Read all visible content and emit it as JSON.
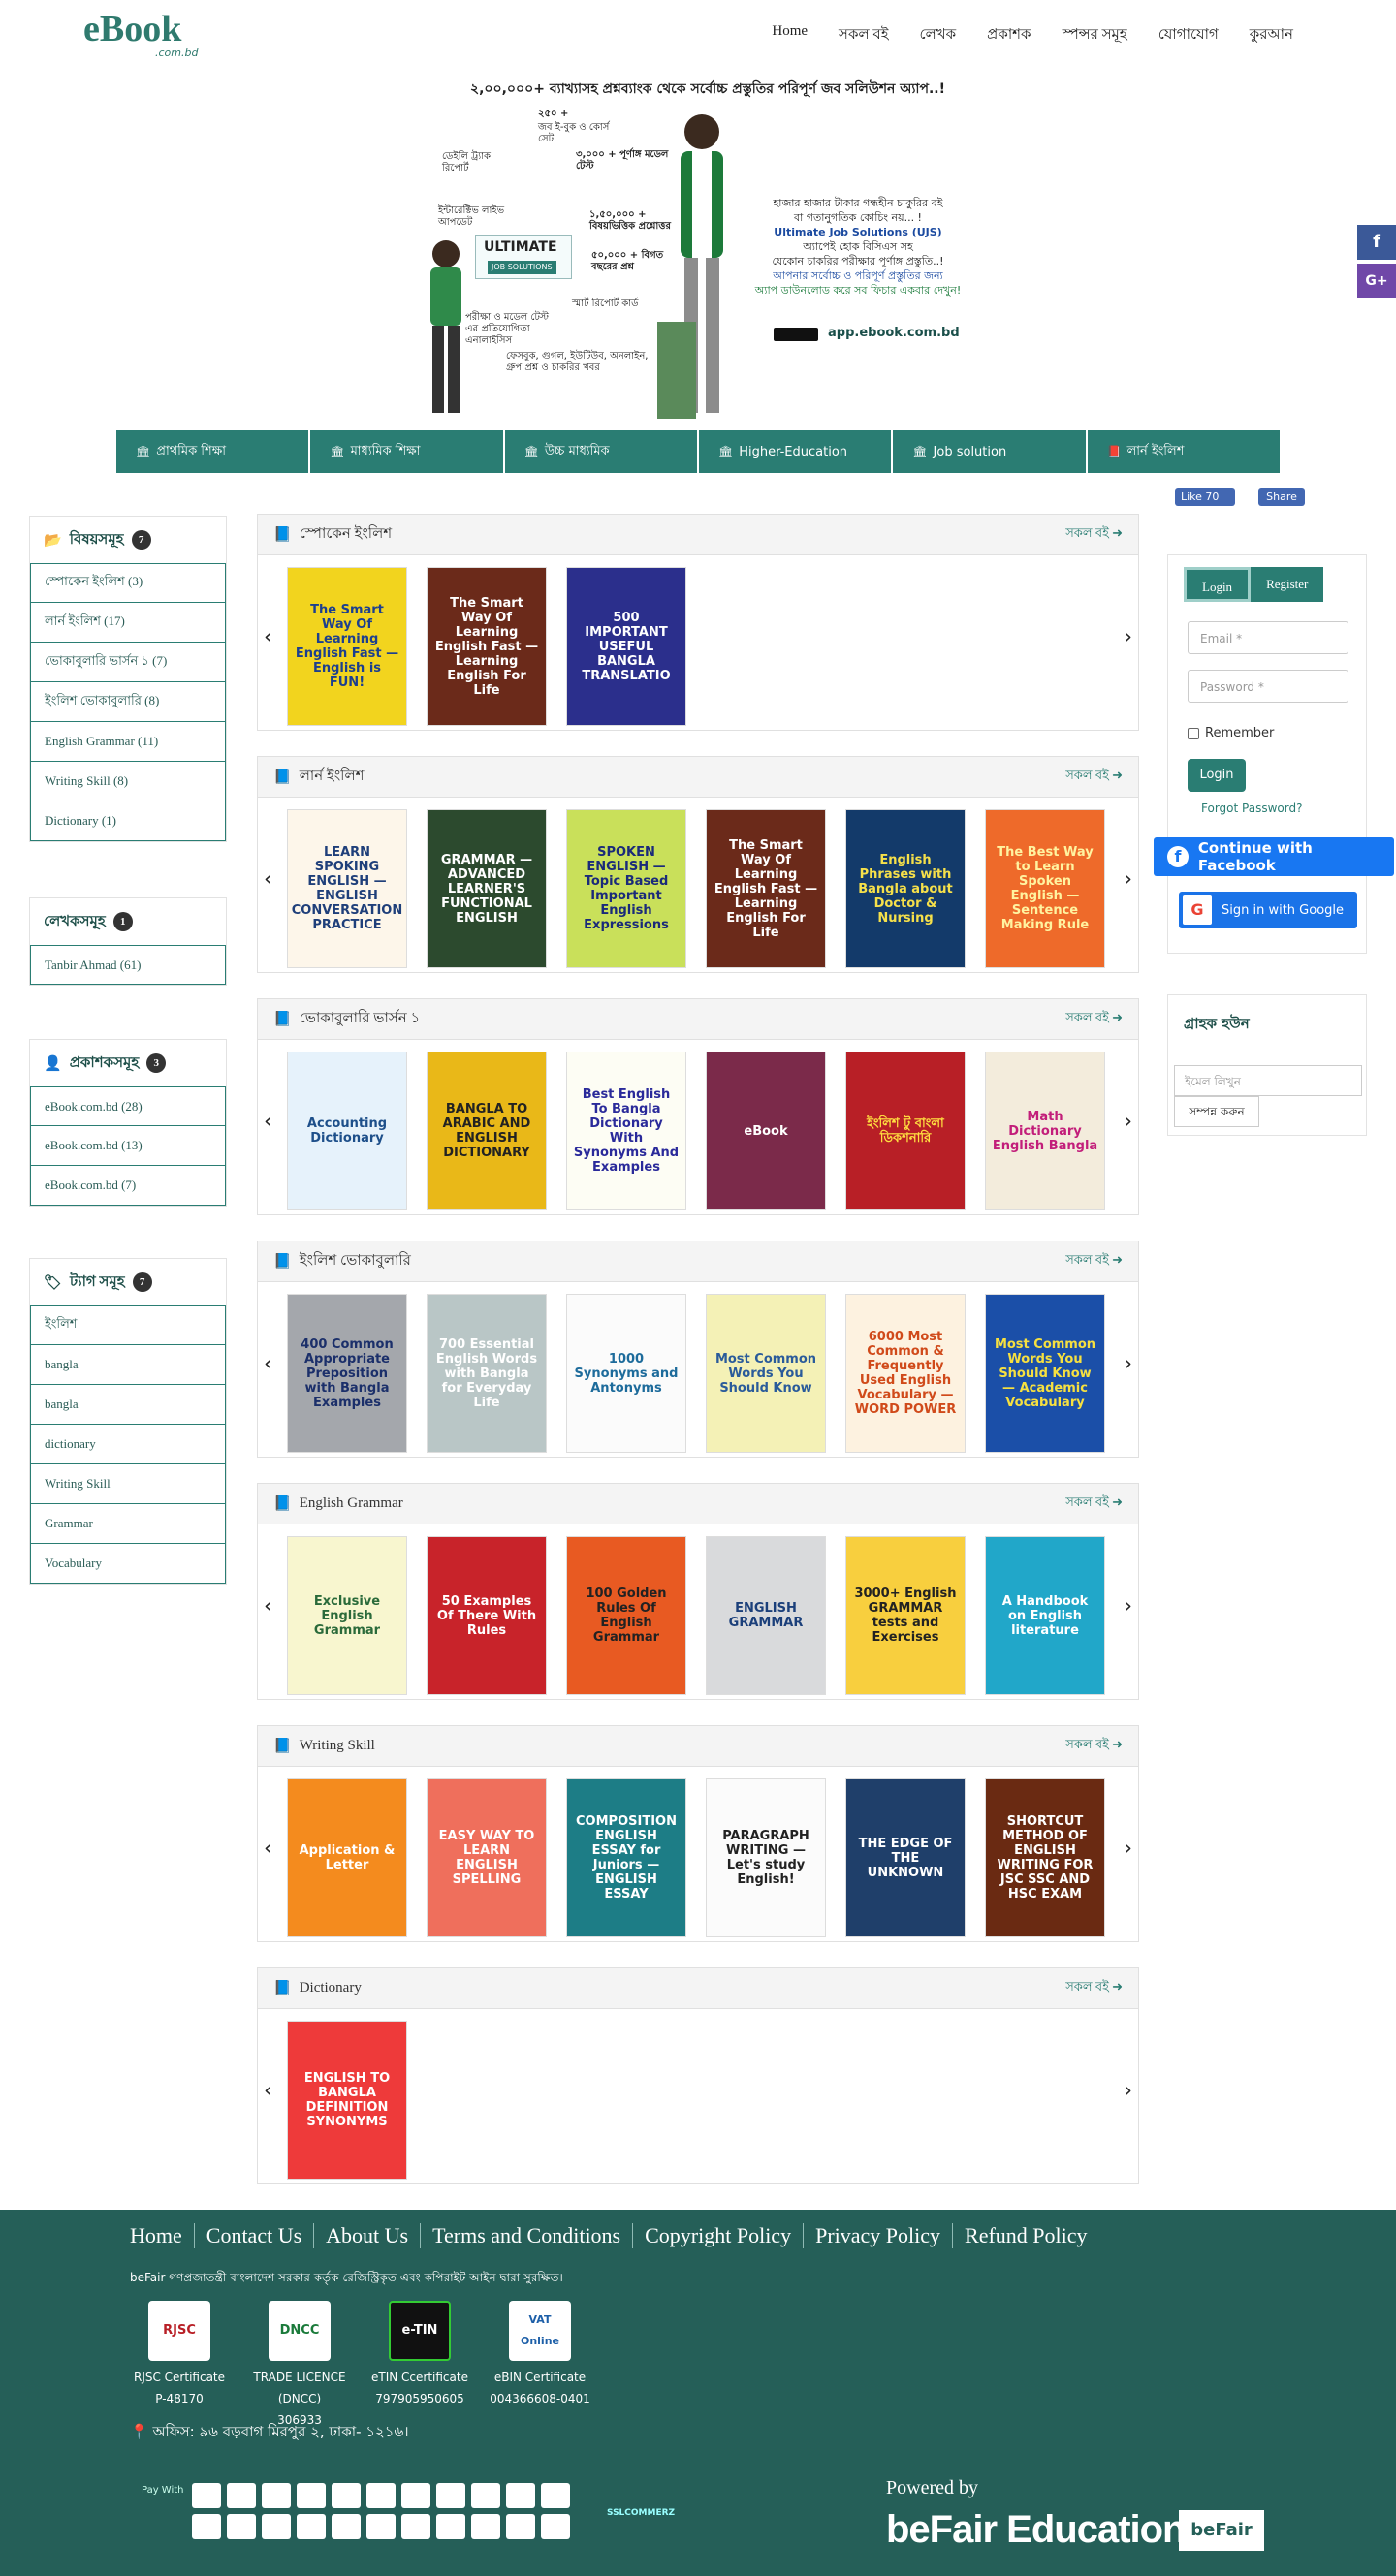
{
  "header": {
    "logo_main": "eBook",
    "logo_sub": ".com.bd",
    "nav": [
      "Home",
      "সকল বই",
      "লেখক",
      "প্রকাশক",
      "স্পন্সর সমূহ",
      "যোগাযোগ",
      "কুরআন"
    ]
  },
  "banner": {
    "title": "২,০০,০০০+ ব্যাখ্যাসহ প্রশ্নব্যাংক থেকে সর্বোচ্চ প্রস্তুতির পরিপূর্ণ জব সলিউশন অ্যাপ..!",
    "labels": [
      "২৫০ +",
      "জব ই-বুক ও কোর্স সেট",
      "ডেইলি ট্র্যাক রিপোর্ট",
      "৩,০০০ + পূর্ণাঙ্গ মডেল টেস্ট",
      "ইন্টারেক্টিভ লাইভ আপডেট",
      "১,৫০,০০০ + বিষয়ভিত্তিক প্রশ্নোত্তর",
      "৫০,০০০ + বিগত বছরের প্রশ্ন",
      "ULTIMATE",
      "JOB SOLUTIONS",
      "স্মার্ট রিপোর্ট কার্ড",
      "পরীক্ষা ও মডেল টেস্ট এর প্রতিযোগিতা এনালাইসিস",
      "ফেসবুক, গুগল, ইউটিউব, অনলাইন, গ্রুপ প্রশ্ন ও চাকরির খবর"
    ],
    "right_text": [
      "হাজার হাজার টাকার গন্ধহীন চাকুরির বই",
      "বা গতানুগতিক কোচিং নয়... !",
      "Ultimate Job Solutions (UJS)",
      "অ্যাপেই হোক বিসিএস সহ",
      "যেকোন চাকরির পরীক্ষার পূর্ণাঙ্গ প্রস্তুতি..!",
      "আপনার সর্বোচ্চ ও পরিপূর্ণ প্রস্তুতির জন্য",
      "অ্যাপ ডাউনলোড করে সব ফিচার একবার দেখুন!"
    ],
    "url": "app.ebook.com.bd"
  },
  "categories": [
    {
      "icon": "building-icon",
      "glyph": "🏛",
      "label": "প্রাথমিক শিক্ষা"
    },
    {
      "icon": "building-icon",
      "glyph": "🏛",
      "label": "মাধ্যমিক শিক্ষা"
    },
    {
      "icon": "building-icon",
      "glyph": "🏛",
      "label": "উচ্চ মাধ্যমিক"
    },
    {
      "icon": "building-icon",
      "glyph": "🏛",
      "label": "Higher-Education"
    },
    {
      "icon": "building-icon",
      "glyph": "🏛",
      "label": "Job solution"
    },
    {
      "icon": "book-icon",
      "glyph": "📕",
      "label": "লার্ন ইংলিশ"
    }
  ],
  "social": {
    "fb_like": "Like 70",
    "fb_share": "Share",
    "side_fb": "f",
    "side_gp": "G+"
  },
  "sidebar": {
    "subjects": {
      "title": "বিষয়সমূহ",
      "count": "7",
      "items": [
        "স্পোকেন ইংলিশ (3)",
        "লার্ন ইংলিশ (17)",
        "ভোকাবুলারি ভার্সন ১ (7)",
        "ইংলিশ ভোকাবুলারি (8)",
        "English Grammar (11)",
        "Writing Skill (8)",
        "Dictionary (1)"
      ]
    },
    "authors": {
      "title": "লেখকসমূহ",
      "count": "1",
      "items": [
        "Tanbir Ahmad (61)"
      ]
    },
    "publishers": {
      "title": "প্রকাশকসমূহ",
      "count": "3",
      "items": [
        "eBook.com.bd (28)",
        "eBook.com.bd (13)",
        "eBook.com.bd (7)"
      ]
    },
    "tags": {
      "title": "ট্যাগ সমূহ",
      "count": "7",
      "items": [
        "ইংলিশ",
        "bangla",
        "bangla",
        "dictionary",
        "Writing Skill",
        "Grammar",
        "Vocabulary"
      ]
    }
  },
  "sections": [
    {
      "title": "স্পোকেন ইংলিশ",
      "all": "সকল বই",
      "books": [
        {
          "text": "The Smart Way Of Learning English Fast — English is FUN!",
          "bg": "#f2d41e",
          "fg": "#1c3f8f"
        },
        {
          "text": "The Smart Way Of Learning English Fast — Learning English For Life",
          "bg": "#6b2a1a",
          "fg": "#ffffff"
        },
        {
          "text": "500 IMPORTANT USEFUL BANGLA TRANSLATIO",
          "bg": "#2b2f8c",
          "fg": "#ffffff"
        }
      ]
    },
    {
      "title": "লার্ন ইংলিশ",
      "all": "সকল বই",
      "books": [
        {
          "text": "LEARN SPOKING ENGLISH — ENGLISH CONVERSATION PRACTICE",
          "bg": "#fdf6ea",
          "fg": "#1f3f7a"
        },
        {
          "text": "GRAMMAR — ADVANCED LEARNER'S FUNCTIONAL ENGLISH",
          "bg": "#2c4a2e",
          "fg": "#ffffff"
        },
        {
          "text": "SPOKEN ENGLISH — Topic Based Important English Expressions",
          "bg": "#c9e05a",
          "fg": "#1a2a7a"
        },
        {
          "text": "The Smart Way Of Learning English Fast — Learning English For Life",
          "bg": "#6b2a1a",
          "fg": "#ffffff"
        },
        {
          "text": "English Phrases with Bangla about Doctor & Nursing",
          "bg": "#133a6a",
          "fg": "#f6e04a"
        },
        {
          "text": "The Best Way to Learn Spoken English — Sentence Making Rule",
          "bg": "#ee6a2a",
          "fg": "#fff3a0"
        }
      ]
    },
    {
      "title": "ভোকাবুলারি ভার্সন ১",
      "all": "সকল বই",
      "books": [
        {
          "text": "Accounting Dictionary",
          "bg": "#e6f2fb",
          "fg": "#1d4f8a"
        },
        {
          "text": "BANGLA TO ARABIC AND ENGLISH DICTIONARY",
          "bg": "#e9b818",
          "fg": "#222222"
        },
        {
          "text": "Best English To Bangla Dictionary With Synonyms And Examples",
          "bg": "#fdfdf4",
          "fg": "#2a2a9a"
        },
        {
          "text": "eBook",
          "bg": "#7b2a4a",
          "fg": "#ffffff"
        },
        {
          "text": "ইংলিশ টু বাংলা ডিকশনারি",
          "bg": "#b81f26",
          "fg": "#ffe040"
        },
        {
          "text": "Math Dictionary English Bangla",
          "bg": "#f3ecdc",
          "fg": "#c21e7a"
        }
      ]
    },
    {
      "title": "ইংলিশ ভোকাবুলারি",
      "all": "সকল বই",
      "books": [
        {
          "text": "400 Common Appropriate Preposition with Bangla Examples",
          "bg": "#a4a7ac",
          "fg": "#1b2f6a"
        },
        {
          "text": "700 Essential English Words with Bangla for Everyday Life",
          "bg": "#b9c6c6",
          "fg": "#ffffff"
        },
        {
          "text": "1000 Synonyms and Antonyms",
          "bg": "#fbfbfb",
          "fg": "#1d6b9b"
        },
        {
          "text": "Most Common Words You Should Know",
          "bg": "#f4f1b6",
          "fg": "#2a5b9a"
        },
        {
          "text": "6000 Most Common & Frequently Used English Vocabulary — WORD POWER",
          "bg": "#fdf2e0",
          "fg": "#d04a1a"
        },
        {
          "text": "Most Common Words You Should Know — Academic Vocabulary",
          "bg": "#1b4fa8",
          "fg": "#f6e040"
        }
      ]
    },
    {
      "title": "English Grammar",
      "all": "সকল বই",
      "books": [
        {
          "text": "Exclusive English Grammar",
          "bg": "#f8f6cf",
          "fg": "#2a6a3a"
        },
        {
          "text": "50 Examples Of There With Rules",
          "bg": "#c8232a",
          "fg": "#ffffff"
        },
        {
          "text": "100 Golden Rules Of English Grammar",
          "bg": "#e85a22",
          "fg": "#222222"
        },
        {
          "text": "ENGLISH GRAMMAR",
          "bg": "#d9dadc",
          "fg": "#1b3f7a"
        },
        {
          "text": "3000+ English GRAMMAR tests and Exercises",
          "bg": "#f8cf3e",
          "fg": "#222222"
        },
        {
          "text": "A Handbook on English literature",
          "bg": "#21a7c9",
          "fg": "#ffffff"
        }
      ]
    },
    {
      "title": "Writing Skill",
      "all": "সকল বই",
      "books": [
        {
          "text": "Application & Letter",
          "bg": "#f48b1e",
          "fg": "#ffffff"
        },
        {
          "text": "EASY WAY TO LEARN ENGLISH SPELLING",
          "bg": "#ef6f5c",
          "fg": "#ffffff"
        },
        {
          "text": "COMPOSITION ENGLISH ESSAY for Juniors — ENGLISH ESSAY",
          "bg": "#1d7d86",
          "fg": "#ffffff"
        },
        {
          "text": "PARAGRAPH WRITING — Let's study English!",
          "bg": "#fbfbfb",
          "fg": "#222222"
        },
        {
          "text": "THE EDGE OF THE UNKNOWN",
          "bg": "#1f3f6a",
          "fg": "#ffffff"
        },
        {
          "text": "SHORTCUT METHOD OF ENGLISH WRITING FOR JSC SSC AND HSC EXAM",
          "bg": "#6a2a12",
          "fg": "#ffffff"
        }
      ]
    },
    {
      "title": "Dictionary",
      "all": "সকল বই",
      "books": [
        {
          "text": "ENGLISH TO BANGLA DEFINITION SYNONYMS",
          "bg": "#ee3a3a",
          "fg": "#ffffff"
        }
      ]
    }
  ],
  "auth": {
    "tab_login": "Login",
    "tab_register": "Register",
    "email_placeholder": "Email *",
    "password_placeholder": "Password *",
    "remember": "Remember",
    "login_btn": "Login",
    "forgot": "Forgot Password?",
    "facebook": "Continue with Facebook",
    "google": "Sign in with Google"
  },
  "subscribe": {
    "title": "গ্রাহক হউন",
    "placeholder": "ইমেল লিখুন",
    "button": "সম্পন্ন করুন"
  },
  "footer": {
    "links": [
      "Home",
      "Contact Us",
      "About Us",
      "Terms and Conditions",
      "Copyright Policy",
      "Privacy Policy",
      "Refund Policy"
    ],
    "note": "beFair গণপ্রজাতন্ত্রী বাংলাদেশ সরকার কর্তৃক রেজিস্ট্রিকৃত এবং কপিরাইট আইন দ্বারা সুরক্ষিত।",
    "certs": [
      {
        "name": "RJSC Certificate",
        "code": "P-48170",
        "mark": "RJSC"
      },
      {
        "name": "TRADE LICENCE (DNCC)",
        "code": "306933",
        "mark": "DNCC"
      },
      {
        "name": "eTIN Ccertificate",
        "code": "797905950605",
        "mark": "e-TIN"
      },
      {
        "name": "eBIN Certificate",
        "code": "004366608-0401",
        "mark": "VAT Online"
      }
    ],
    "address": "অফিস: ৯৬ বড়বাগ মিরপুর ২, ঢাকা- ১২১৬।",
    "pay_with": "Pay With",
    "ssl": "SSLCOMMERZ",
    "powered": "Powered by",
    "brand": "beFair Education",
    "brand_logo": "beFair"
  }
}
